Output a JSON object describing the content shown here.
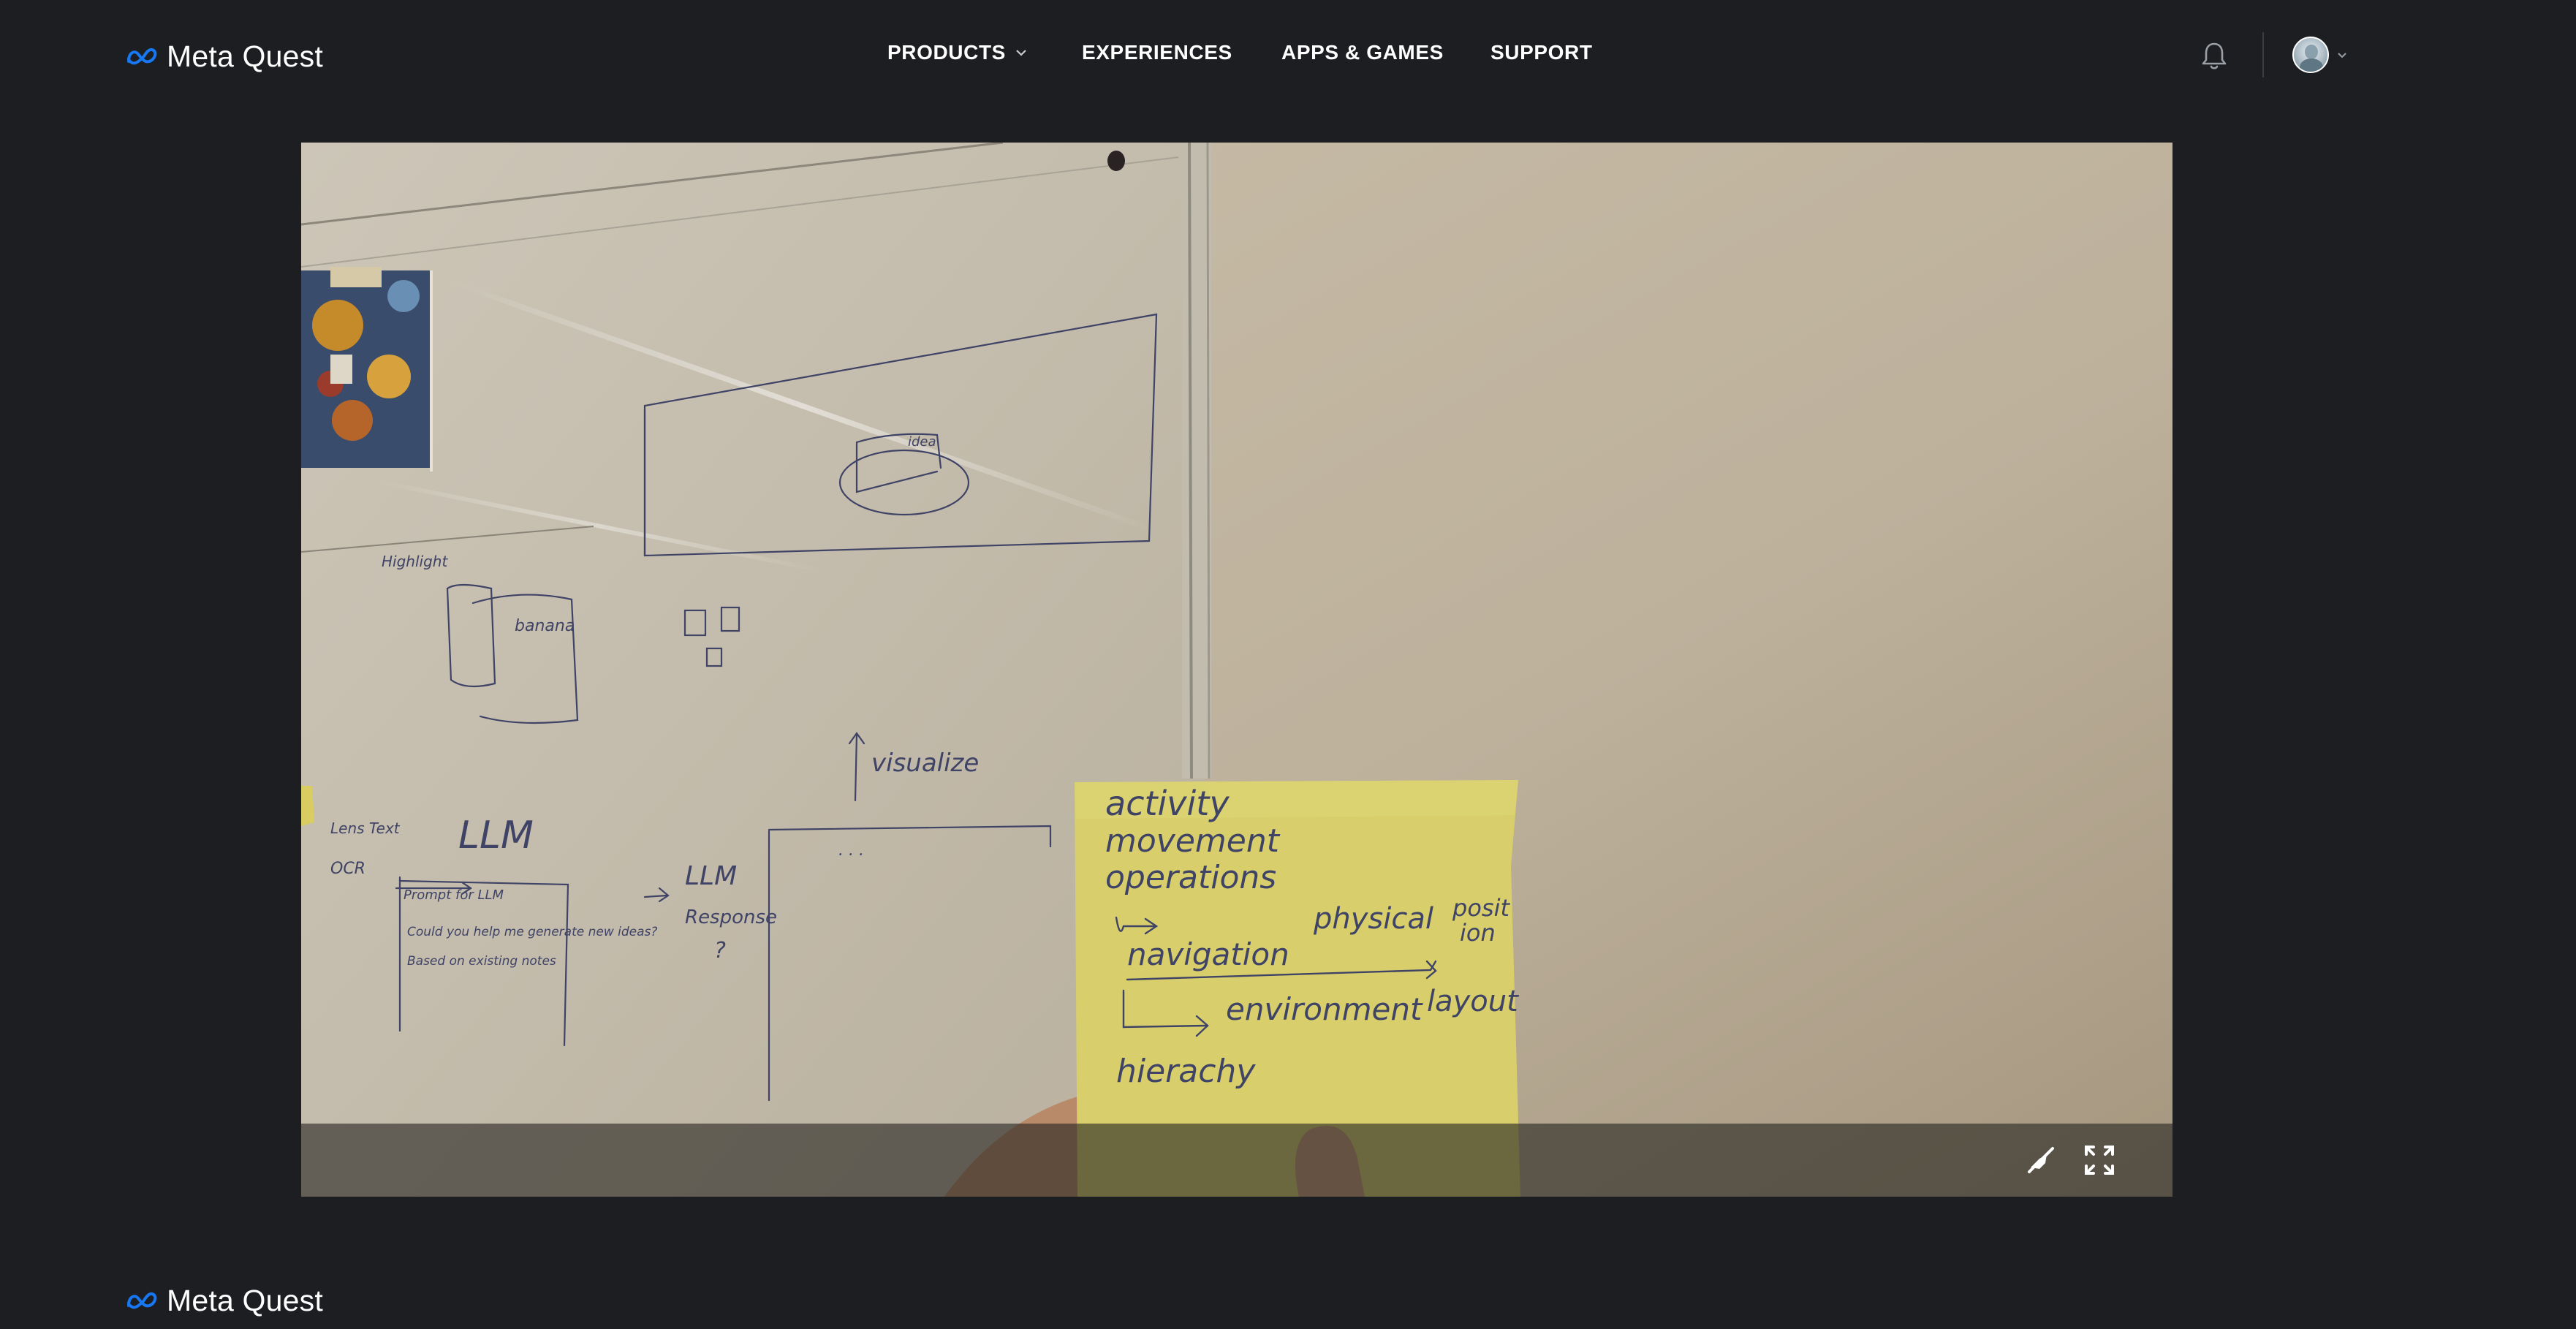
{
  "brand": {
    "name": "Meta Quest",
    "accent": "#1877f2"
  },
  "nav": {
    "items": [
      {
        "label": "PRODUCTS",
        "has_dropdown": true
      },
      {
        "label": "EXPERIENCES"
      },
      {
        "label": "APPS & GAMES"
      },
      {
        "label": "SUPPORT"
      }
    ]
  },
  "header_icons": {
    "notifications": "bell-icon",
    "account": "avatar",
    "account_menu": "chevron-down-icon"
  },
  "video": {
    "whiteboard_text": {
      "banner": "Highlight",
      "box_label": "banana",
      "idea_label": "idea",
      "arrow_label": "visualize",
      "input_label": "Lens Text",
      "ocr_label": "OCR",
      "llm_title": "LLM",
      "prompt_lines": [
        "Prompt for LLM",
        "Could you help me generate new ideas?",
        "Based on existing notes"
      ],
      "response_lines": [
        "LLM",
        "Response",
        "?"
      ],
      "dots": ". . ."
    },
    "sticky_note": {
      "color": "#dcd36f",
      "lines": [
        "activity",
        "movement",
        "operations",
        "navigation",
        "physical",
        "posit",
        "ion",
        "environment",
        "layout",
        "hierachy"
      ]
    },
    "controls": {
      "mute": "mute-icon",
      "fullscreen": "fullscreen-icon"
    }
  },
  "footer": {
    "brand": "Meta Quest"
  }
}
